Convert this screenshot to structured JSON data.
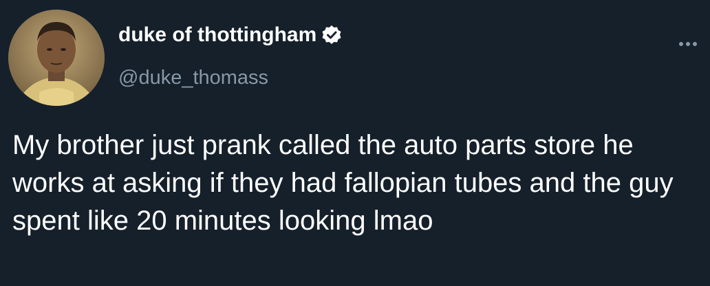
{
  "user": {
    "display_name": "duke of thottingham",
    "handle": "@duke_thomass",
    "verified": true,
    "avatar_icon": "profile-avatar"
  },
  "tweet": {
    "text": "My brother just prank called the auto parts store he works at asking if they had fallopian tubes and the guy spent like 20 minutes looking lmao"
  },
  "icons": {
    "verified": "verified-badge-icon",
    "more": "more-options-icon"
  },
  "colors": {
    "background": "#15202b",
    "primary_text": "#ffffff",
    "secondary_text": "#8899a6"
  }
}
